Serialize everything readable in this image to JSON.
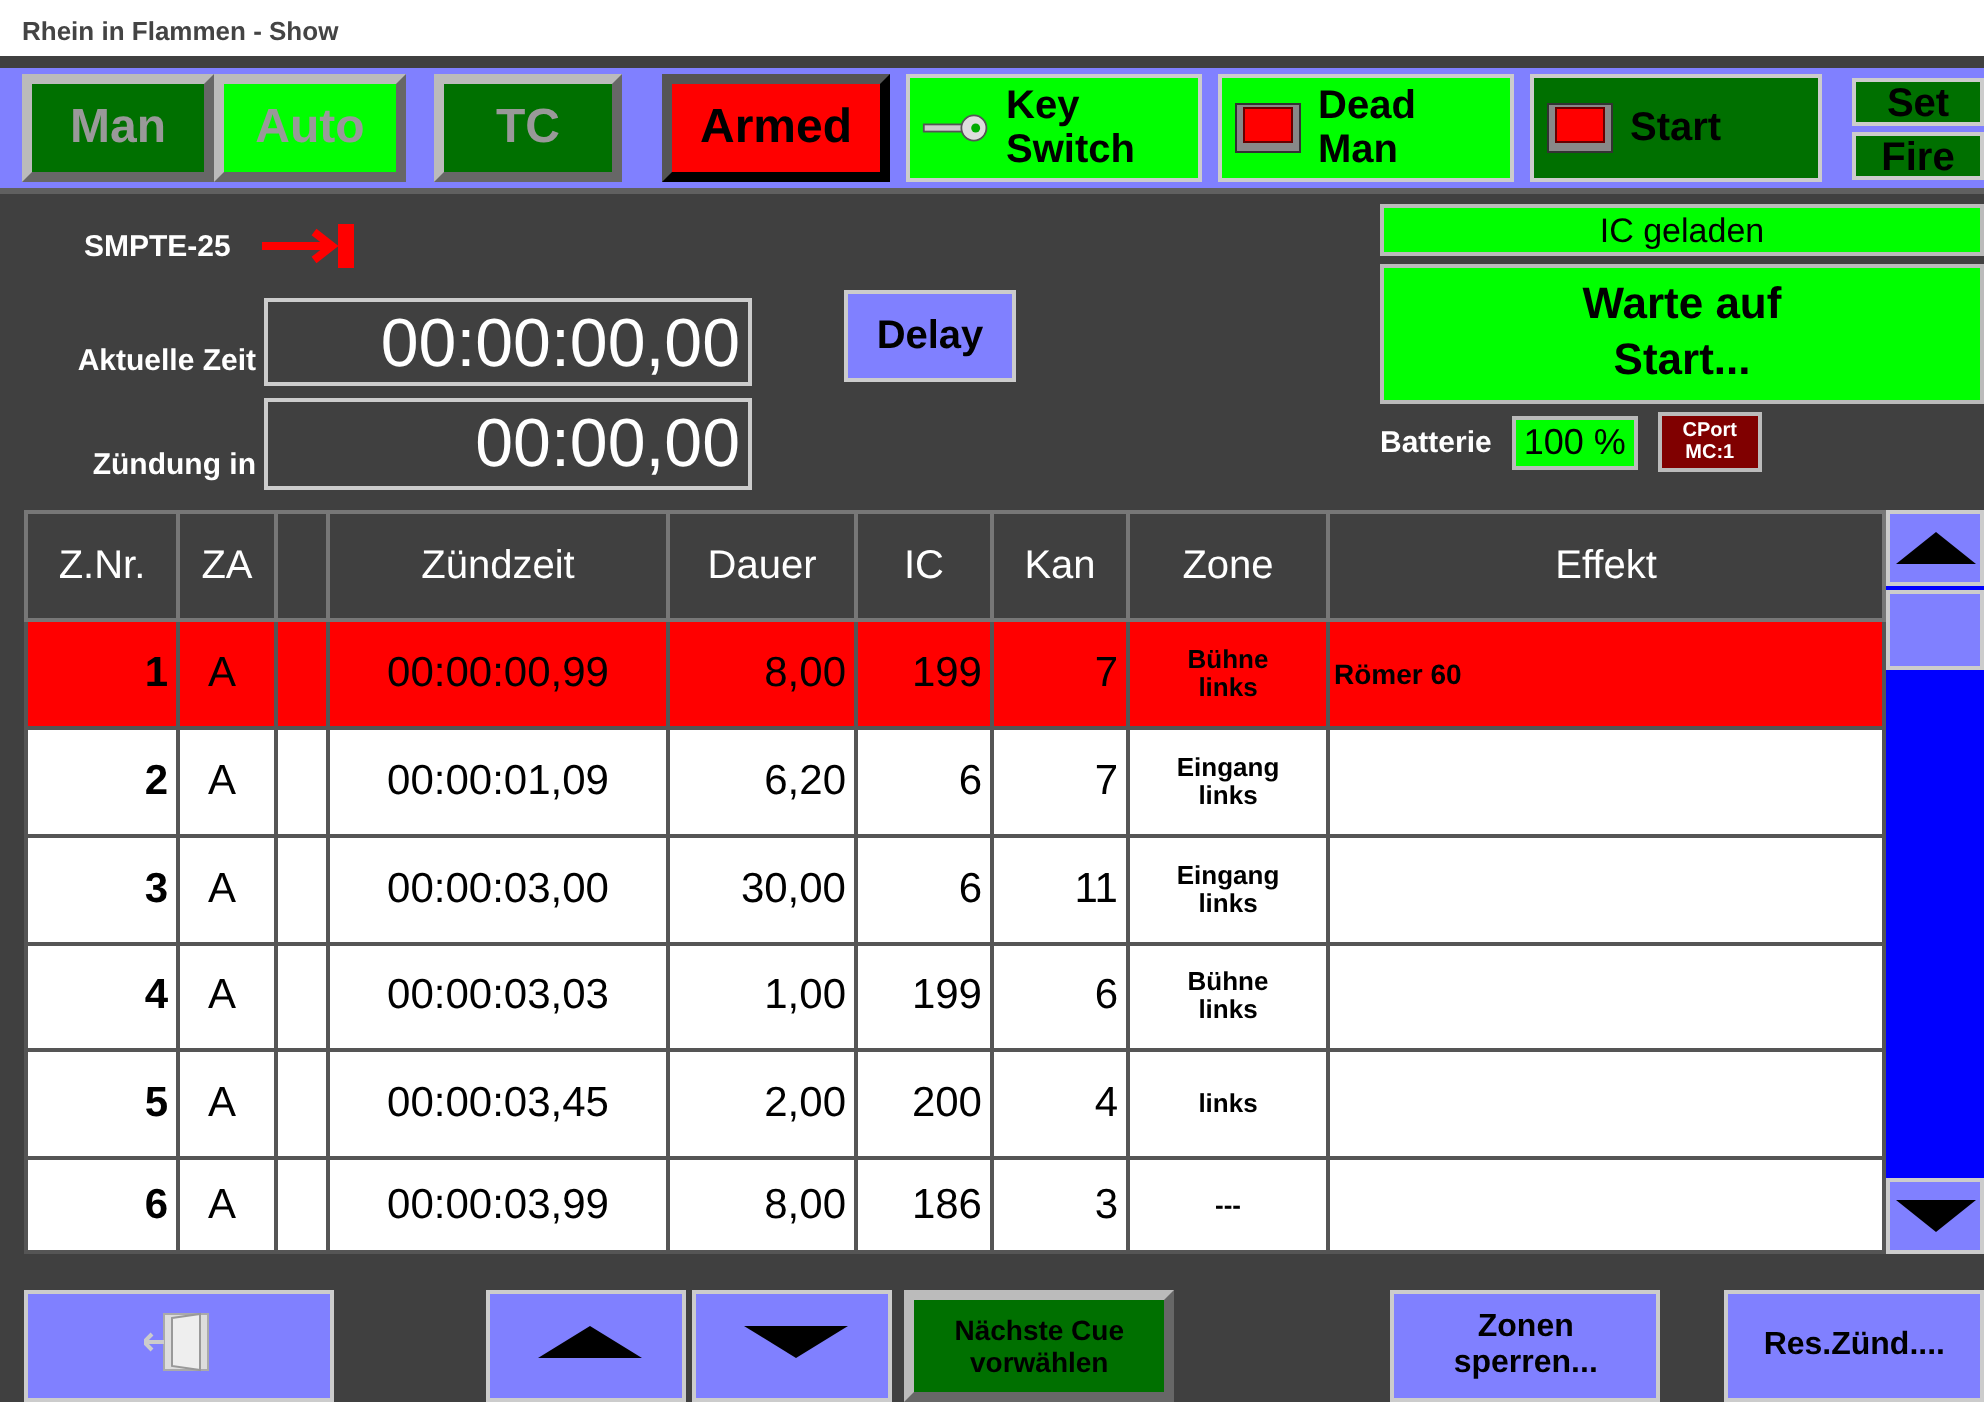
{
  "window": {
    "title": "Rhein in Flammen - Show"
  },
  "toolbar": {
    "modes": [
      {
        "label": "Man",
        "selected": false
      },
      {
        "label": "Auto",
        "selected": true
      }
    ],
    "tc": {
      "label": "TC",
      "on": false
    },
    "armed": {
      "label": "Armed",
      "on": true
    },
    "key_switch": {
      "label": "Key Switch",
      "on": true
    },
    "dead_man": {
      "label": "Dead Man",
      "on": true
    },
    "start": {
      "label": "Start",
      "on": false
    },
    "set": "Set",
    "fire": "Fire"
  },
  "timecode": {
    "format": "SMPTE-25",
    "current_label": "Aktuelle Zeit",
    "current": "00:00:00,00",
    "fire_label": "Zündung in",
    "fire_in": "00:00,00",
    "delay_button": "Delay"
  },
  "status": {
    "ic": "IC geladen",
    "message": "Warte auf Start...",
    "battery_label": "Batterie",
    "battery": "100 %",
    "port": "CPort MC:1"
  },
  "table": {
    "columns": [
      "Z.Nr.",
      "ZA",
      "Zündzeit",
      "Dauer",
      "IC",
      "Kan",
      "Zone",
      "Effekt"
    ],
    "rows": [
      {
        "nr": "1",
        "za": "A",
        "time": "00:00:00,99",
        "dauer": "8,00",
        "ic": "199",
        "kan": "7",
        "zone": "Bühne links",
        "effekt": "Römer 60",
        "selected": true
      },
      {
        "nr": "2",
        "za": "A",
        "time": "00:00:01,09",
        "dauer": "6,20",
        "ic": "6",
        "kan": "7",
        "zone": "Eingang links",
        "selected": false
      },
      {
        "nr": "3",
        "za": "A",
        "time": "00:00:03,00",
        "dauer": "30,00",
        "ic": "6",
        "kan": "11",
        "zone": "Eingang links",
        "selected": false
      },
      {
        "nr": "4",
        "za": "A",
        "time": "00:00:03,03",
        "dauer": "1,00",
        "ic": "199",
        "kan": "6",
        "zone": "Bühne links",
        "selected": false
      },
      {
        "nr": "5",
        "za": "A",
        "time": "00:00:03,45",
        "dauer": "2,00",
        "ic": "200",
        "kan": "4",
        "zone": "links",
        "selected": false
      },
      {
        "nr": "6",
        "za": "A",
        "time": "00:00:03,99",
        "dauer": "8,00",
        "ic": "186",
        "kan": "3",
        "zone": "---",
        "selected": false
      }
    ]
  },
  "bottom": {
    "next_cue": "Nächste Cue vorwählen",
    "zones": "Zonen sperren...",
    "reset": "Res.Zünd...."
  }
}
